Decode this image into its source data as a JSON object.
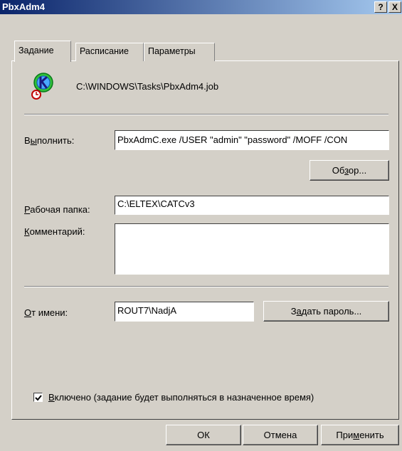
{
  "window": {
    "title": "PbxAdm4",
    "help_btn": "?",
    "close_btn": "X"
  },
  "tabs": [
    {
      "label": "Задание",
      "active": true
    },
    {
      "label": "Расписание",
      "active": false
    },
    {
      "label": "Параметры",
      "active": false
    }
  ],
  "task": {
    "icon": "scheduled-task-icon",
    "path": "C:\\WINDOWS\\Tasks\\PbxAdm4.job"
  },
  "run": {
    "label_pre": "В",
    "label_u": "ы",
    "label_post": "полнить:",
    "value": "PbxAdmC.exe /USER \"admin\" \"password\" /MOFF /CON",
    "browse_pre": "Об",
    "browse_u": "з",
    "browse_post": "ор..."
  },
  "workdir": {
    "label_u": "Р",
    "label_post": "абочая папка:",
    "value": "C:\\ELTEX\\CATCv3"
  },
  "comment": {
    "label_u": "К",
    "label_post": "омментарий:",
    "value": ""
  },
  "run_as": {
    "label_u": "О",
    "label_post": "т имени:",
    "value": "ROUT7\\NadjA",
    "set_password_pre": "З",
    "set_password_u": "а",
    "set_password_post": "дать пароль..."
  },
  "enabled": {
    "checked": true,
    "label_u": "В",
    "label_post": "ключено (задание будет выполняться в назначенное время)"
  },
  "buttons": {
    "ok": "ОК",
    "cancel": "Отмена",
    "apply_pre": "При",
    "apply_u": "м",
    "apply_post": "енить"
  }
}
